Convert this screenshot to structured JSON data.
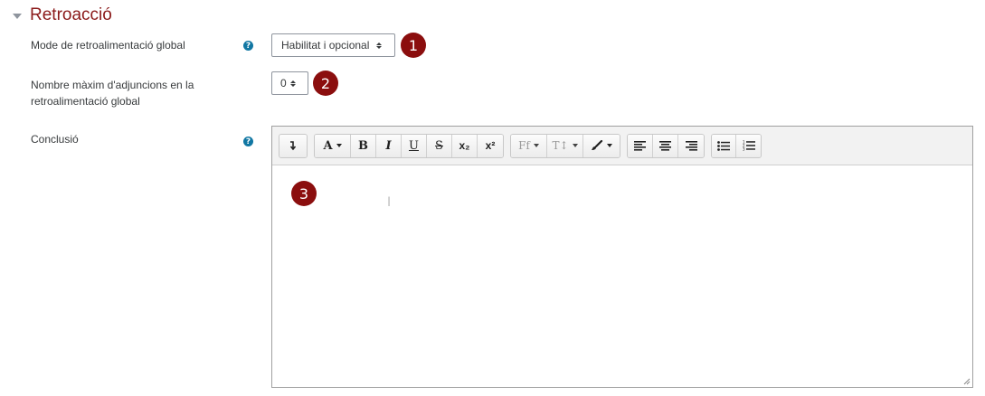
{
  "section": {
    "title": "Retroacció",
    "collapse_icon": "caret-down-icon"
  },
  "fields": {
    "feedback_mode": {
      "label": "Mode de retroalimentació global",
      "value": "Habilitat i opcional",
      "help_icon": "question-circle-icon"
    },
    "max_attachments": {
      "label_line1": "Nombre màxim d'adjuncions en la",
      "label_line2": "retroalimentació global",
      "value": "0"
    },
    "conclusion": {
      "label": "Conclusió",
      "help_icon": "question-circle-icon"
    }
  },
  "badges": [
    "1",
    "2",
    "3"
  ],
  "toolbar": {
    "show_more_icon": "show-more-buttons-icon",
    "font_color_label": "A",
    "bold": "B",
    "italic": "I",
    "underline": "U",
    "strikethrough": "S",
    "subscript": "x₂",
    "superscript": "x²",
    "font_family_label": "Ff",
    "font_size_label": "T↕",
    "paintbrush_icon": "paintbrush-icon",
    "align_left_icon": "align-left-icon",
    "align_center_icon": "align-center-icon",
    "align_right_icon": "align-right-icon",
    "unordered_list_icon": "unordered-list-icon",
    "ordered_list_icon": "ordered-list-icon"
  },
  "colors": {
    "accent": "#8b1a1a",
    "badge": "#8b0e0e",
    "help": "#1177a3"
  }
}
